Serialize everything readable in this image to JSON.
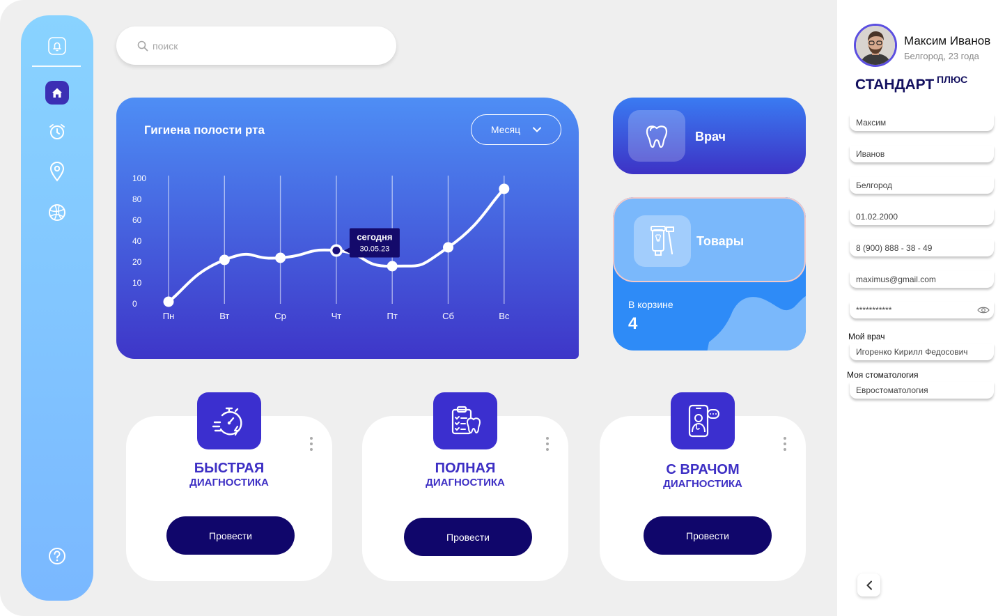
{
  "search": {
    "placeholder": "поиск"
  },
  "hygiene_chart": {
    "title": "Гигиена полости рта",
    "period": "Месяц",
    "tooltip": {
      "label": "сегодня",
      "date": "30.05.23"
    }
  },
  "chart_data": {
    "type": "line",
    "title": "Гигиена полости рта",
    "categories": [
      "Пн",
      "Вт",
      "Ср",
      "Чт",
      "Пт",
      "Сб",
      "Вс"
    ],
    "y_ticks": [
      "100",
      "80",
      "60",
      "40",
      "20",
      "10",
      "0"
    ],
    "series": [
      {
        "values": [
          1,
          22,
          24,
          31,
          18,
          34,
          90
        ]
      }
    ],
    "highlight_index": 3,
    "grid": "vertical lines only",
    "legend": "none"
  },
  "doctor_card": {
    "label": "Врач",
    "icon": "tooth-icon"
  },
  "goods_card": {
    "label": "Товары",
    "icon": "toothpaste-brush-icon",
    "cart_label": "В корзине",
    "cart_count": "4"
  },
  "diagnostics": [
    {
      "title": "БЫСТРАЯ",
      "subtitle": "ДИАГНОСТИКА",
      "button": "Провести",
      "icon": "stopwatch-icon"
    },
    {
      "title": "ПОЛНАЯ",
      "subtitle": "ДИАГНОСТИКА",
      "button": "Провести",
      "icon": "clipboard-tooth-icon"
    },
    {
      "title": "С ВРАЧОМ",
      "subtitle": "ДИАГНОСТИКА",
      "button": "Провести",
      "icon": "video-call-doctor-icon"
    }
  ],
  "profile": {
    "name": "Максим Иванов",
    "location": "Белгород, 23 года",
    "plan": "СТАНДАРТ",
    "plan_suffix": "ПЛЮС",
    "fields": {
      "first_name": "Максим",
      "last_name": "Иванов",
      "city": "Белгород",
      "birth_date": "01.02.2000",
      "phone": "8 (900) 888 - 38 - 49",
      "email": "maximus@gmail.com",
      "password": "***********"
    },
    "my_doctor_label": "Мой врач",
    "my_doctor": "Игоренко Кирилл Федосович",
    "my_clinic_label": "Моя стоматология",
    "my_clinic": "Евростоматология"
  },
  "colors": {
    "accent": "#3b2fcf",
    "button": "#10066b",
    "sidebar": "#7ab8ff",
    "chart_top": "#4e8ef5",
    "chart_bottom": "#3e36c8"
  }
}
